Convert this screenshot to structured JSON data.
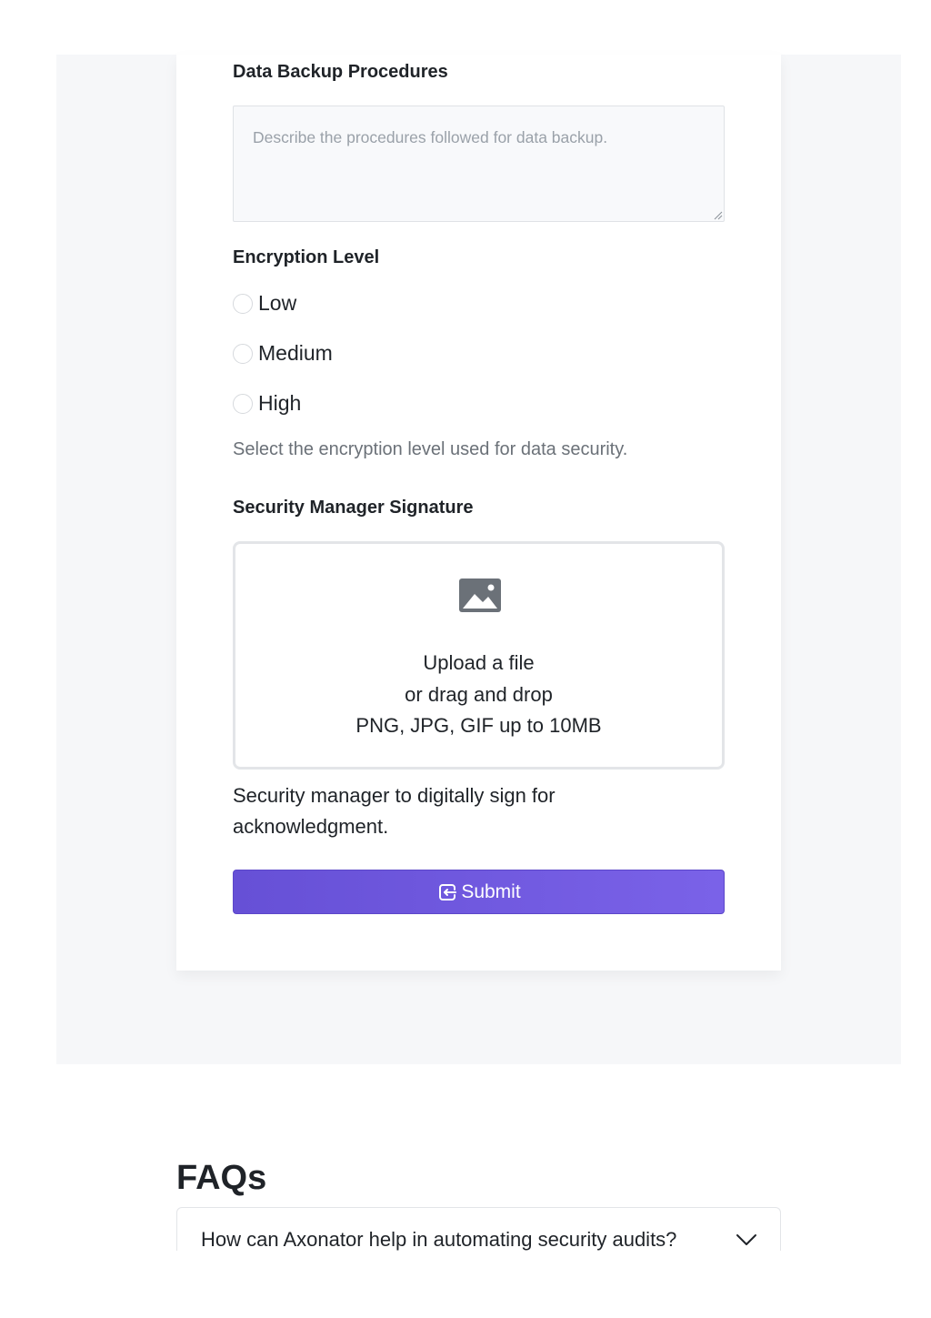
{
  "form": {
    "backup": {
      "label": "Data Backup Procedures",
      "placeholder": "Describe the procedures followed for data backup."
    },
    "encryption": {
      "label": "Encryption Level",
      "options": [
        "Low",
        "Medium",
        "High"
      ],
      "help": "Select the encryption level used for data security."
    },
    "signature": {
      "label": "Security Manager Signature",
      "upload_line1": "Upload a file",
      "upload_line2": "or drag and drop",
      "upload_line3": "PNG, JPG, GIF up to 10MB",
      "upload_icon": "image-icon",
      "description": "Security manager to digitally sign for acknowledgment."
    },
    "submit": {
      "label": "Submit",
      "icon": "sign-in-icon",
      "gradient_start": "#6650d6",
      "gradient_end": "#7a62e8"
    }
  },
  "faqs": {
    "title": "FAQs",
    "items": [
      {
        "question": "How can Axonator help in automating security audits?"
      }
    ]
  }
}
